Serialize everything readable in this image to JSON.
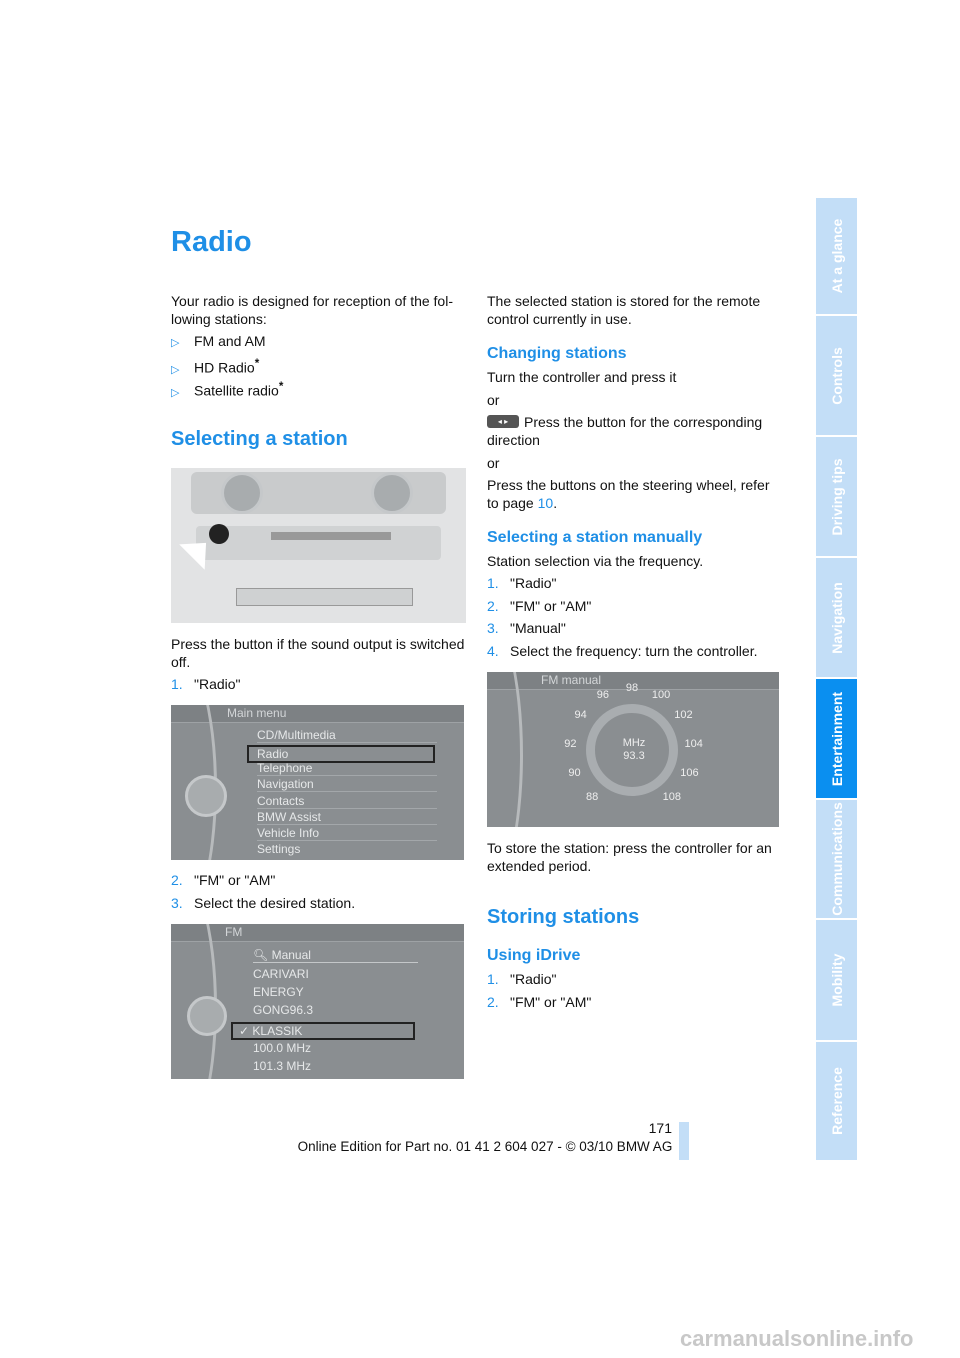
{
  "title": "Radio",
  "left": {
    "intro": "Your radio is designed for reception of the fol-lowing stations:",
    "intro_line1": "Your radio is designed for reception of the fol-",
    "intro_line2": "lowing stations:",
    "bullets": [
      {
        "text": "FM and AM",
        "star": ""
      },
      {
        "text": "HD Radio",
        "star": "*"
      },
      {
        "text": "Satellite radio",
        "star": "*"
      }
    ],
    "section": "Selecting a station",
    "img1_caption_l1": "Press the button if the sound output is switched",
    "img1_caption_l2": "off.",
    "step1": {
      "n": "1.",
      "t": "\"Radio\""
    },
    "main_menu": {
      "title": "Main menu",
      "items": [
        "CD/Multimedia",
        "Radio",
        "Telephone",
        "Navigation",
        "Contacts",
        "BMW Assist",
        "Vehicle Info",
        "Settings"
      ],
      "selected": "Radio"
    },
    "step2": {
      "n": "2.",
      "t": "\"FM\" or \"AM\""
    },
    "step3": {
      "n": "3.",
      "t": "Select the desired station."
    },
    "fm_menu": {
      "title": "FM",
      "items": [
        "Manual",
        "CARIVARI",
        "ENERGY",
        "GONG96.3",
        "KLASSIK",
        "100.0 MHz",
        "101.3 MHz"
      ],
      "selected": "KLASSIK"
    }
  },
  "right": {
    "stored_l1": "The selected station is stored for the remote",
    "stored_l2": "control currently in use.",
    "changing": "Changing stations",
    "turn": "Turn the controller and press it",
    "or": "or",
    "press_btn_l1": "Press the button for the corresponding",
    "press_btn_l2": "direction",
    "steering_l1": "Press the buttons on the steering wheel, refer",
    "steering_l2_pre": "to page ",
    "steering_page": "10",
    "manual_heading": "Selecting a station manually",
    "manual_intro": "Station selection via the frequency.",
    "steps": [
      {
        "n": "1.",
        "t": "\"Radio\""
      },
      {
        "n": "2.",
        "t": "\"FM\" or \"AM\""
      },
      {
        "n": "3.",
        "t": "\"Manual\""
      },
      {
        "n": "4.",
        "t": "Select the frequency: turn the controller."
      }
    ],
    "fm_manual": {
      "title": "FM manual",
      "unit": "MHz",
      "frequency": "93.3",
      "scale": [
        "88",
        "90",
        "92",
        "94",
        "96",
        "98",
        "100",
        "102",
        "104",
        "106",
        "108"
      ]
    },
    "store_l1": "To store the station: press the controller for an",
    "store_l2": "extended period.",
    "storing": "Storing stations",
    "idrive": "Using iDrive",
    "steps2": [
      {
        "n": "1.",
        "t": "\"Radio\""
      },
      {
        "n": "2.",
        "t": "\"FM\" or \"AM\""
      }
    ]
  },
  "footer": {
    "page": "171",
    "edition": "Online Edition for Part no. 01 41 2 604 027 - © 03/10 BMW AG"
  },
  "sidebar": {
    "tabs": [
      "At a glance",
      "Controls",
      "Driving tips",
      "Navigation",
      "Entertainment",
      "Communications",
      "Mobility",
      "Reference"
    ],
    "active": "Entertainment"
  },
  "watermark": "carmanualsonline.info",
  "colors": {
    "accent": "#1f8fe6",
    "tab": "#c3def7",
    "tab_active": "#0a8ff0"
  }
}
